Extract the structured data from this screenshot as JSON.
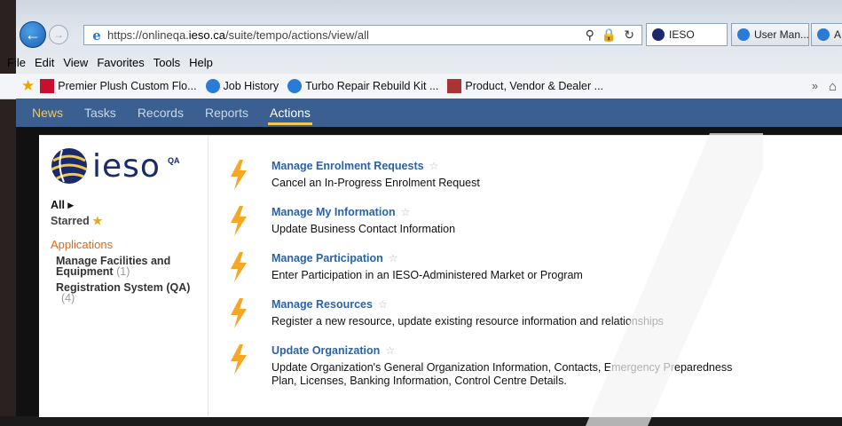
{
  "browser": {
    "url_prefix": "https://onlineqa.",
    "url_host": "ieso.ca",
    "url_path": "/suite/tempo/actions/view/all",
    "tabs": [
      {
        "label": "IESO"
      },
      {
        "label": "User Man..."
      },
      {
        "label": "A"
      }
    ],
    "menu": [
      "File",
      "Edit",
      "View",
      "Favorites",
      "Tools",
      "Help"
    ],
    "favorites": [
      {
        "label": "Premier Plush Custom Flo..."
      },
      {
        "label": "Job History"
      },
      {
        "label": "Turbo Repair Rebuild Kit ..."
      },
      {
        "label": "Product, Vendor & Dealer ..."
      }
    ],
    "overflow": "»"
  },
  "nav": {
    "items": [
      "News",
      "Tasks",
      "Records",
      "Reports",
      "Actions"
    ],
    "active": "Actions"
  },
  "logo": {
    "text": "ieso",
    "badge": "QA"
  },
  "sidebar": {
    "all": "All ▸",
    "starred": "Starred",
    "applications_heading": "Applications",
    "apps": [
      {
        "name": "Manage Facilities and Equipment",
        "count": "(1)"
      },
      {
        "name": "Registration System (QA)",
        "count": "(4)"
      }
    ]
  },
  "actions": [
    {
      "title": "Manage Enrolment Requests",
      "desc": "Cancel an In-Progress Enrolment Request"
    },
    {
      "title": "Manage My Information",
      "desc": "Update Business Contact Information"
    },
    {
      "title": "Manage Participation",
      "desc": "Enter Participation in an IESO-Administered Market or Program"
    },
    {
      "title": "Manage Resources",
      "desc": "Register a new resource, update existing resource information and relationships"
    },
    {
      "title": "Update Organization",
      "desc": "Update Organization's General Organization Information, Contacts, Emergency Preparedness Plan, Licenses, Banking Information, Control Centre Details."
    }
  ],
  "colors": {
    "nav_bg": "#3b5f91",
    "nav_highlight": "#f2c94c",
    "link": "#2b62a8",
    "bolt": "#f5a623",
    "accent": "#e06a12"
  }
}
